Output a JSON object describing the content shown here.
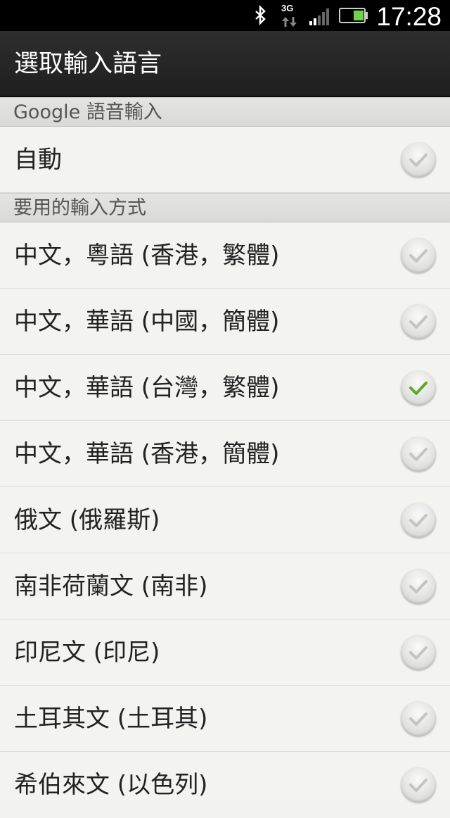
{
  "status_bar": {
    "network": "3G",
    "time": "17:28"
  },
  "title_bar": {
    "title": "選取輸入語言"
  },
  "sections": [
    {
      "header": "Google 語音輸入"
    },
    {
      "header": "要用的輸入方式"
    }
  ],
  "auto_option": {
    "label": "自動",
    "checked": false
  },
  "languages": [
    {
      "label": "中文，粵語 (香港，繁體)",
      "checked": false
    },
    {
      "label": "中文，華語 (中國，簡體)",
      "checked": false
    },
    {
      "label": "中文，華語 (台灣，繁體)",
      "checked": true
    },
    {
      "label": "中文，華語 (香港，簡體)",
      "checked": false
    },
    {
      "label": "俄文 (俄羅斯)",
      "checked": false
    },
    {
      "label": "南非荷蘭文 (南非)",
      "checked": false
    },
    {
      "label": "印尼文 (印尼)",
      "checked": false
    },
    {
      "label": "土耳其文 (土耳其)",
      "checked": false
    },
    {
      "label": "希伯來文 (以色列)",
      "checked": false
    }
  ],
  "colors": {
    "check_active": "#5aaa2a",
    "check_inactive": "#c4c4c1"
  }
}
